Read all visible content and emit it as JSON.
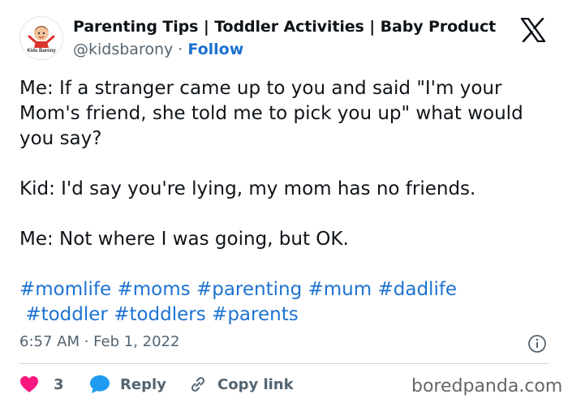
{
  "account": {
    "name": "Parenting Tips | Toddler Activities | Baby Product",
    "handle": "@kidsbarony",
    "separator": "·",
    "follow_label": "Follow",
    "avatar_text": "Kids Barony"
  },
  "tweet": {
    "paragraphs": [
      "Me: If a stranger came up to you and said \"I'm your Mom's friend, she told me to pick you up\" what would you say?",
      "Kid: I'd say you're lying, my mom has no friends.",
      "Me: Not where I was going, but OK."
    ],
    "hashtags": [
      "#momlife",
      "#moms",
      "#parenting",
      "#mum",
      "#dadlife",
      "#toddler",
      "#toddlers",
      "#parents"
    ],
    "timestamp": "6:57 AM · Feb 1, 2022"
  },
  "actions": {
    "like_count": "3",
    "reply_label": "Reply",
    "copy_label": "Copy link"
  },
  "watermark": "boredpanda.com",
  "colors": {
    "link": "#1d72d0",
    "muted": "#536471",
    "heart": "#f91880",
    "reply_bubble": "#1d9bf0"
  },
  "icons": [
    "x-logo-icon",
    "info-icon",
    "heart-icon",
    "speech-bubble-icon",
    "link-icon"
  ]
}
